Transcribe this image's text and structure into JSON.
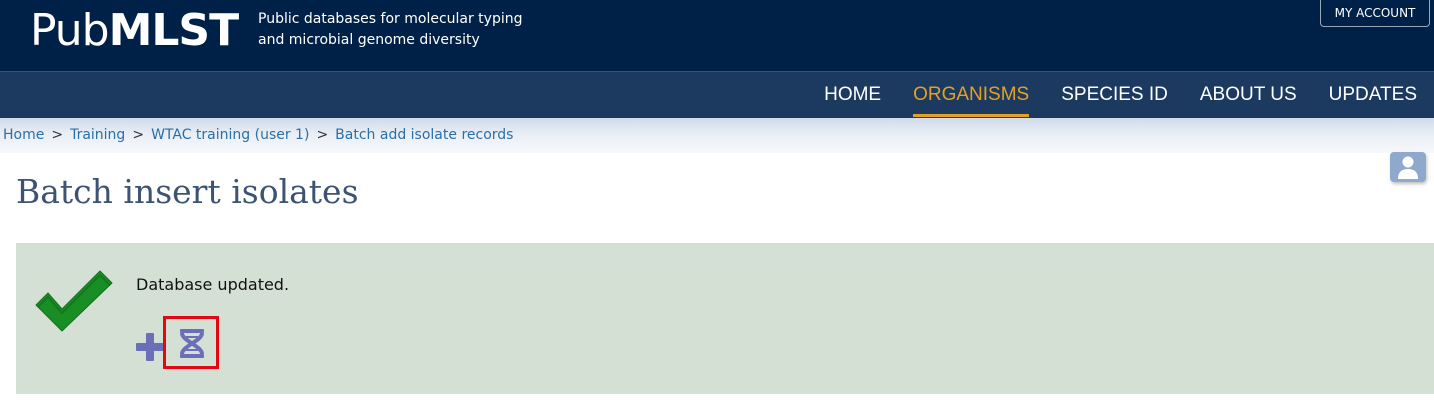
{
  "header": {
    "logo_regular": "Pub",
    "logo_bold": "MLST",
    "tagline_line1": "Public databases for molecular typing",
    "tagline_line2": "and microbial genome diversity",
    "account_button": "MY ACCOUNT",
    "colors": {
      "header_bg": "#002147",
      "nav_bg": "#1c3a60",
      "nav_active": "#e4a125"
    }
  },
  "nav": {
    "items": [
      {
        "label": "HOME",
        "active": false
      },
      {
        "label": "ORGANISMS",
        "active": true
      },
      {
        "label": "SPECIES ID",
        "active": false
      },
      {
        "label": "ABOUT US",
        "active": false
      },
      {
        "label": "UPDATES",
        "active": false
      }
    ]
  },
  "breadcrumb": {
    "items": [
      "Home",
      "Training",
      "WTAC training (user 1)",
      "Batch add isolate records"
    ],
    "separator": ">"
  },
  "user_menu": {
    "icon": "user-icon"
  },
  "page": {
    "title": "Batch insert isolates"
  },
  "message": {
    "text": "Database updated.",
    "status_icon": "checkmark-icon",
    "status_color": "#0f8a1c",
    "actions": [
      {
        "icon": "plus-icon"
      },
      {
        "icon": "dna-icon",
        "highlighted": true
      }
    ],
    "highlight_color": "#e30613",
    "icon_color": "#6b6fb8",
    "bg_color": "#d5e0d5"
  }
}
